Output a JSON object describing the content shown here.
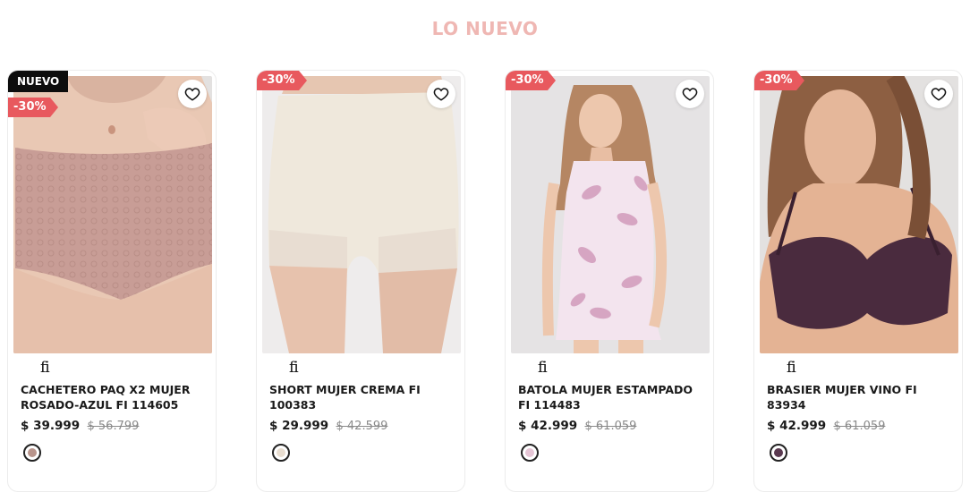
{
  "section": {
    "title": "LO NUEVO"
  },
  "products": [
    {
      "badge_new": "NUEVO",
      "discount": "-30%",
      "brand": "fi",
      "name": "CACHETERO PAQ X2 MUJER ROSADO-AZUL FI 114605",
      "price": "$ 39.999",
      "old_price": "$ 56.799",
      "swatch_color": "#b9958c"
    },
    {
      "discount": "-30%",
      "brand": "fi",
      "name": "SHORT MUJER CREMA FI 100383",
      "price": "$ 29.999",
      "old_price": "$ 42.599",
      "swatch_color": "#e8ddd0"
    },
    {
      "discount": "-30%",
      "brand": "fi",
      "name": "BATOLA MUJER ESTAMPADO FI 114483",
      "price": "$ 42.999",
      "old_price": "$ 61.059",
      "swatch_color": "#e6c6d6"
    },
    {
      "discount": "-30%",
      "brand": "fi",
      "name": "BRASIER MUJER VINO FI 83934",
      "price": "$ 42.999",
      "old_price": "$ 61.059",
      "swatch_color": "#5a3950"
    }
  ],
  "icons": {
    "favorite": "heart-icon"
  },
  "colors": {
    "title": "#efb7b3",
    "discount_badge": "#e8595e",
    "new_badge": "#0d0d0d"
  }
}
